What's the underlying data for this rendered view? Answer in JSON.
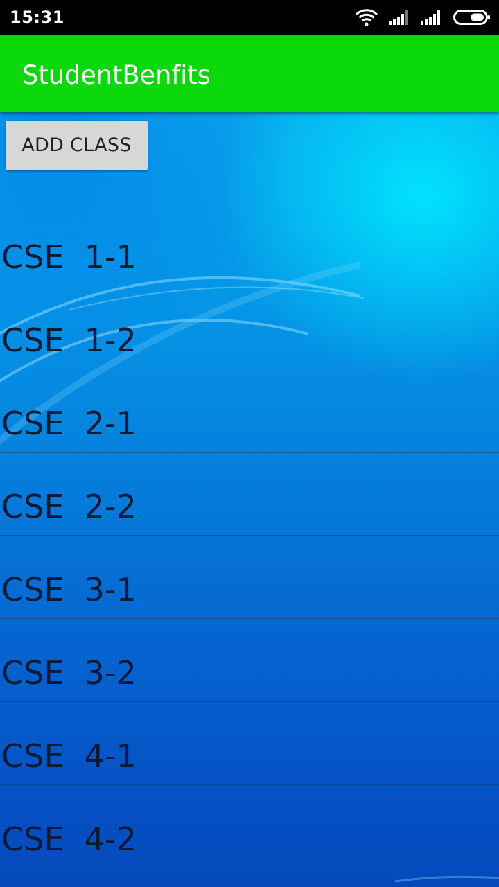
{
  "status_bar": {
    "time": "15:31",
    "icons": [
      "wifi-icon",
      "signal-icon",
      "signal-icon",
      "battery-icon"
    ]
  },
  "app_bar": {
    "title": "StudentBenfits",
    "color": "#0bd80b"
  },
  "actions": {
    "add_class_label": "ADD CLASS"
  },
  "classes": [
    {
      "label": "CSE  1-1"
    },
    {
      "label": "CSE  1-2"
    },
    {
      "label": "CSE  2-1"
    },
    {
      "label": "CSE  2-2"
    },
    {
      "label": "CSE  3-1"
    },
    {
      "label": "CSE  3-2"
    },
    {
      "label": "CSE  4-1"
    },
    {
      "label": "CSE  4-2"
    }
  ]
}
